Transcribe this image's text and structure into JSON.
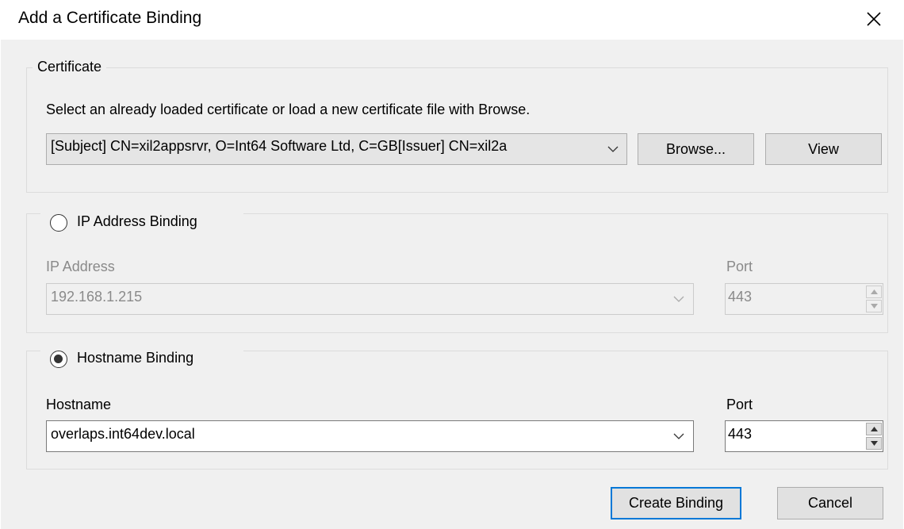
{
  "window": {
    "title": "Add a Certificate Binding"
  },
  "certificate": {
    "legend": "Certificate",
    "instructions": "Select an already loaded certificate or load a new certificate file with Browse.",
    "selected": "[Subject]  CN=xil2appsrvr, O=Int64 Software Ltd, C=GB[Issuer]  CN=xil2a",
    "browse_label": "Browse...",
    "view_label": "View"
  },
  "ip_binding": {
    "legend": "IP Address Binding",
    "selected": false,
    "address_label": "IP Address",
    "address_value": "192.168.1.215",
    "port_label": "Port",
    "port_value": "443"
  },
  "hostname_binding": {
    "legend": "Hostname Binding",
    "selected": true,
    "hostname_label": "Hostname",
    "hostname_value": "overlaps.int64dev.local",
    "port_label": "Port",
    "port_value": "443"
  },
  "footer": {
    "create_label": "Create Binding",
    "cancel_label": "Cancel"
  },
  "colors": {
    "dialog_bg": "#f0f0f0",
    "default_button_border": "#0078d7",
    "disabled_text": "#8a8a8a"
  }
}
